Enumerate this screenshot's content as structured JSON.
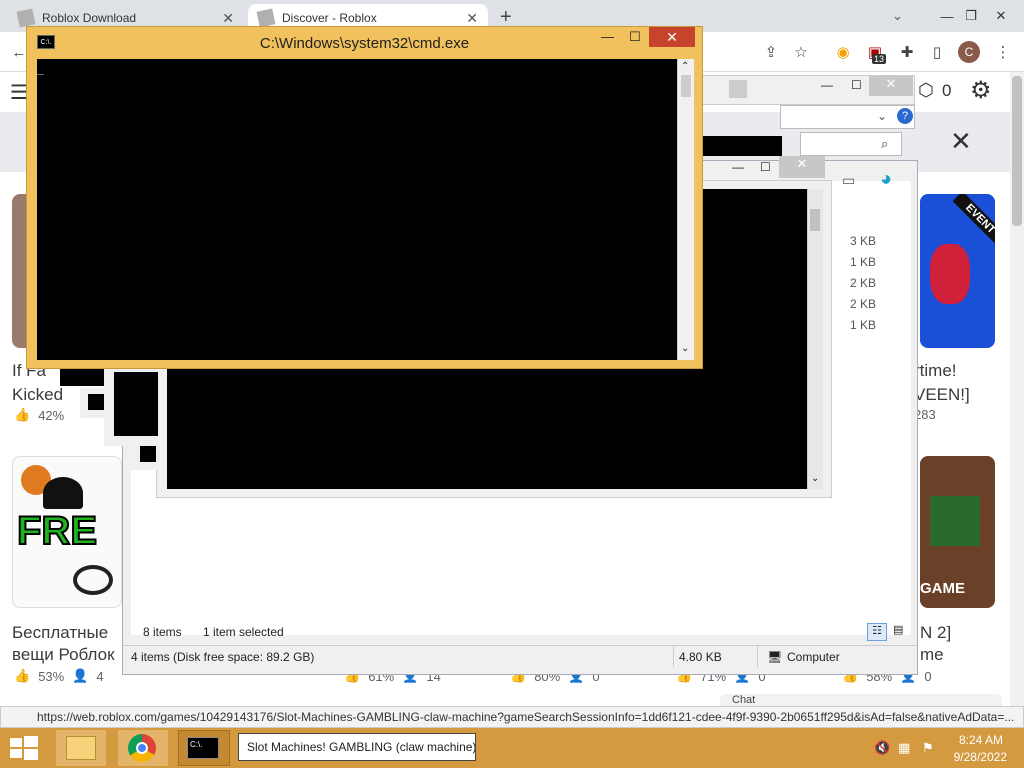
{
  "browser": {
    "tabs": [
      {
        "label": "Roblox Download",
        "close": "✕"
      },
      {
        "label": "Discover - Roblox",
        "close": "✕"
      }
    ],
    "new_tab": "+",
    "profile_initial": "C",
    "extension_badge": "13",
    "window_controls": {
      "minimize": "—",
      "restore": "❐",
      "close": "✕"
    },
    "status_url": "https://web.roblox.com/games/10429143176/Slot-Machines-GAMBLING-claw-machine?gameSearchSessionInfo=1dd6f121-cdee-4f9f-9390-2b0651ff295d&isAd=false&nativeAdData=..."
  },
  "roblox": {
    "robux_count": "0",
    "close_label": "✕",
    "games": [
      {
        "title_line1": "If Fa",
        "title_line2": "Kicked",
        "likes": "42%",
        "players": ""
      },
      {
        "title_line1": "rtime!",
        "title_line2": "VEEN!]",
        "likes": "",
        "players": "283"
      },
      {
        "title_line1": "Бесплатные",
        "title_line2": "вещи Роблок",
        "likes": "53%",
        "players": "4"
      },
      {
        "title_line1": "N 2]",
        "title_line2": "me",
        "likes": "58%",
        "players": "0"
      }
    ],
    "row_stats": [
      {
        "likes": "61%",
        "players": "14"
      },
      {
        "likes": "80%",
        "players": "0"
      },
      {
        "likes": "71%",
        "players": "0"
      }
    ],
    "free_text": "FRE",
    "event_badge": "EVENT",
    "game_badge": "GAME",
    "chat_label": "Chat"
  },
  "explorer": {
    "file_sizes": [
      "3 KB",
      "1 KB",
      "2 KB",
      "2 KB",
      "1 KB"
    ],
    "items_count": "8 items",
    "selected": "1 item selected",
    "status_left": "4 items (Disk free space: 89.2 GB)",
    "status_size": "4.80 KB",
    "status_location": "Computer",
    "help": "?"
  },
  "cmd": {
    "title": "C:\\Windows\\system32\\cmd.exe",
    "icon_text": "C:\\.",
    "cursor": "_"
  },
  "taskbar": {
    "active_label": "Slot Machines! GAMBLING (claw machine)",
    "time": "8:24 AM",
    "date": "9/28/2022"
  },
  "colors": {
    "cmd_frame": "#f0c15d",
    "taskbar": "#d49a3f",
    "console": "#000000"
  }
}
